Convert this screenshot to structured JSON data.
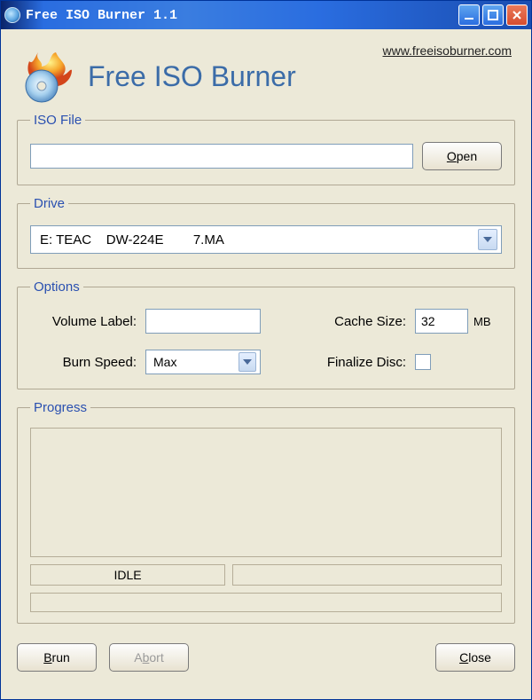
{
  "titlebar": {
    "title": "Free ISO Burner 1.1"
  },
  "header": {
    "link": "www.freeisoburner.com",
    "appTitle": "Free ISO Burner"
  },
  "iso": {
    "legend": "ISO File",
    "value": "",
    "openLabel": "Open",
    "openMnemonic": "O"
  },
  "drive": {
    "legend": "Drive",
    "selected": "E: TEAC    DW-224E        7.MA"
  },
  "options": {
    "legend": "Options",
    "volumeLabelText": "Volume Label:",
    "volumeLabelValue": "",
    "cacheSizeText": "Cache Size:",
    "cacheSizeValue": "32",
    "cacheSizeUnit": "MB",
    "burnSpeedText": "Burn Speed:",
    "burnSpeedValue": "Max",
    "finalizeText": "Finalize Disc:",
    "finalizeChecked": false
  },
  "progress": {
    "legend": "Progress",
    "status": "IDLE"
  },
  "buttons": {
    "burnLabel": "Brun",
    "burnMnemonic": "B",
    "abortLabel": "Abort",
    "abortMnemonic": "A",
    "closeLabel": "Close",
    "closeMnemonic": "C"
  }
}
